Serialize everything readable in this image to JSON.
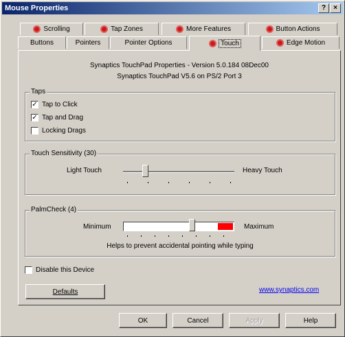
{
  "window": {
    "title": "Mouse Properties",
    "help_glyph": "?",
    "close_glyph": "×"
  },
  "tabs_back": [
    {
      "label": "Scrolling",
      "has_icon": true
    },
    {
      "label": "Tap Zones",
      "has_icon": true
    },
    {
      "label": "More Features",
      "has_icon": true
    },
    {
      "label": "Button Actions",
      "has_icon": true
    }
  ],
  "tabs_front": [
    {
      "label": "Buttons",
      "has_icon": false
    },
    {
      "label": "Pointers",
      "has_icon": false
    },
    {
      "label": "Pointer Options",
      "has_icon": false
    },
    {
      "label": "Touch",
      "has_icon": true,
      "active": true
    },
    {
      "label": "Edge Motion",
      "has_icon": true
    }
  ],
  "info": {
    "line1": "Synaptics TouchPad Properties - Version 5.0.184 08Dec00",
    "line2": "Synaptics TouchPad V5.6 on PS/2 Port 3"
  },
  "taps": {
    "legend": "Taps",
    "items": [
      {
        "label": "Tap to Click",
        "checked": true
      },
      {
        "label": "Tap and Drag",
        "checked": true
      },
      {
        "label": "Locking Drags",
        "checked": false
      }
    ]
  },
  "touch_sensitivity": {
    "legend": "Touch Sensitivity (30)",
    "left_label": "Light Touch",
    "right_label": "Heavy Touch",
    "value_fraction": 0.2
  },
  "palmcheck": {
    "legend": "PalmCheck (4)",
    "left_label": "Minimum",
    "right_label": "Maximum",
    "hint": "Helps to prevent accidental pointing while typing",
    "value_fraction": 0.62,
    "danger_color": "#ff0000"
  },
  "disable_device": {
    "label": "Disable this Device",
    "checked": false
  },
  "defaults_button": "Defaults",
  "link": "www.synaptics.com",
  "footer": {
    "ok": "OK",
    "cancel": "Cancel",
    "apply": "Apply",
    "help": "Help"
  },
  "check_glyph": "✓"
}
